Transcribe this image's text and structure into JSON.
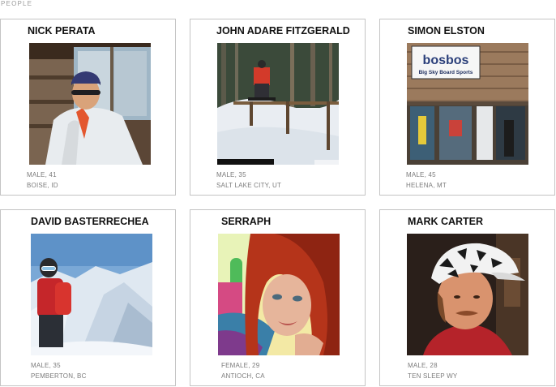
{
  "section": {
    "title": "PEOPLE"
  },
  "people": [
    {
      "name": "NICK PERATA",
      "details": "MALE, 41",
      "location": "BOISE, ID",
      "photo": "photo-man-in-white-jacket"
    },
    {
      "name": "JOHN ADARE FITZGERALD",
      "details": "MALE, 35",
      "location": "SALT LAKE CITY, UT",
      "photo": "photo-snowboarder-on-rail"
    },
    {
      "name": "SIMON ELSTON",
      "details": "MALE, 45",
      "location": "HELENA, MT",
      "photo": "photo-board-shop-storefront"
    },
    {
      "name": "DAVID BASTERRECHEA",
      "details": "MALE, 35",
      "location": "PEMBERTON, BC",
      "photo": "photo-mountaineer-in-snow"
    },
    {
      "name": "SERRAPH",
      "details": "FEMALE, 29",
      "location": "ANTIOCH, CA",
      "photo": "photo-red-haired-woman"
    },
    {
      "name": "MARK CARTER",
      "details": "MALE, 28",
      "location": "TEN SLEEP WY",
      "photo": "photo-man-in-patterned-cap"
    }
  ],
  "store_sign": {
    "logo": "bosbos",
    "subtitle": "Big Sky Board Sports"
  },
  "colors": {
    "card_border": "#c4c4c4",
    "name_text": "#111111",
    "meta_text": "#7c7c7c",
    "section_text": "#9a9a9a"
  }
}
